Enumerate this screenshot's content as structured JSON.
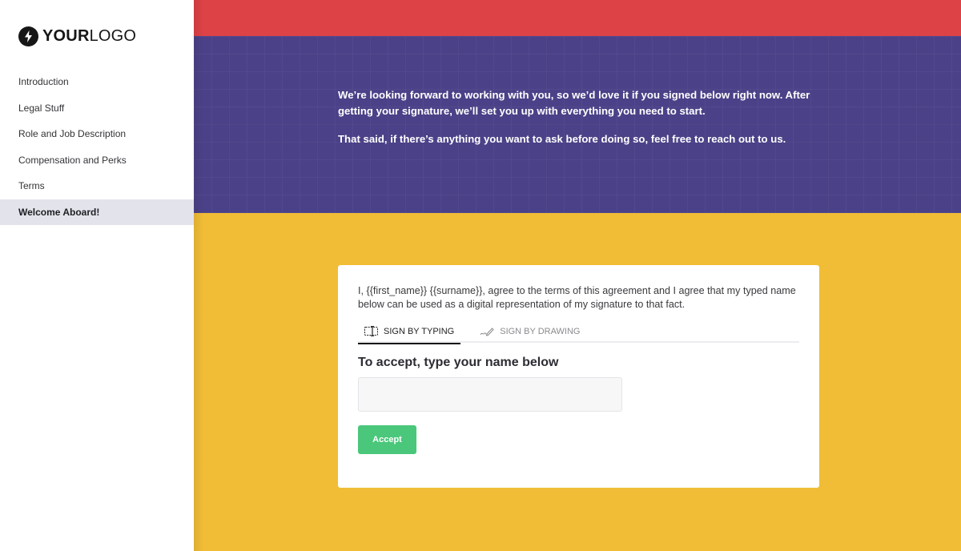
{
  "brand": {
    "logo_bold": "YOUR",
    "logo_light": "LOGO",
    "logo_icon": "lightning-bolt-icon"
  },
  "sidebar": {
    "items": [
      {
        "label": "Introduction",
        "active": false
      },
      {
        "label": "Legal Stuff",
        "active": false
      },
      {
        "label": "Role and Job Description",
        "active": false
      },
      {
        "label": "Compensation and Perks",
        "active": false
      },
      {
        "label": "Terms",
        "active": false
      },
      {
        "label": "Welcome Aboard!",
        "active": true
      }
    ]
  },
  "intro": {
    "paragraph1": "We’re looking forward to working with you, so we’d love it if you signed below right now. After getting your signature, we’ll set you up with everything you need to start.",
    "paragraph2": "That said, if there’s anything you want to ask before doing so, feel free to reach out to us."
  },
  "signature_card": {
    "agreement_text": "I, {{first_name}} {{surname}}, agree to the terms of this agreement and I agree that my typed name below can be used as a digital representation of my signature to that fact.",
    "tabs": [
      {
        "label": "SIGN BY TYPING",
        "icon": "text-cursor-box-icon",
        "active": true
      },
      {
        "label": "SIGN BY DRAWING",
        "icon": "pen-signature-icon",
        "active": false
      }
    ],
    "section_title": "To accept, type your name below",
    "name_input": {
      "value": "",
      "placeholder": ""
    },
    "accept_label": "Accept"
  },
  "colors": {
    "red_band": "#dc4246",
    "purple_band": "#4b4188",
    "yellow_band": "#f1bd36",
    "accept_button": "#4ac77a",
    "active_nav_bg": "#e3e4eb"
  }
}
